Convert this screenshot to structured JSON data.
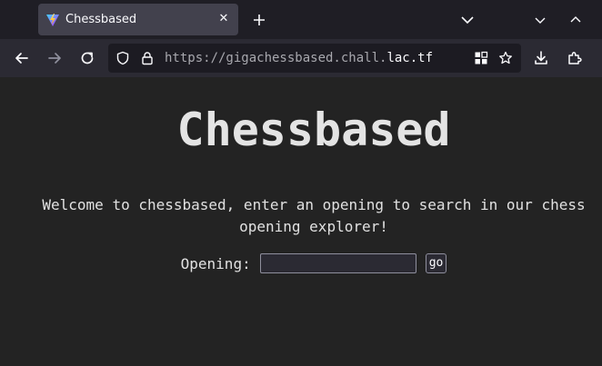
{
  "browser": {
    "tab": {
      "title": "Chessbased",
      "close_glyph": "✕",
      "favicon": "vite-logo-icon"
    },
    "icons": {
      "new_tab": "plus-icon",
      "tab_list": "chevron-down-icon",
      "minimize": "chevron-down-icon",
      "maximize": "chevron-up-icon",
      "back": "arrow-left-icon",
      "forward": "arrow-right-icon",
      "reload": "reload-icon",
      "tracking_protection": "shield-icon",
      "site_security": "lock-icon",
      "extensions_grid": "grid-icon",
      "bookmark": "star-icon",
      "downloads": "download-icon",
      "extensions": "puzzle-icon"
    },
    "url": {
      "prefix": "https://gigachessbased.chall.",
      "domain": "lac.tf"
    },
    "colors": {
      "tabstrip_bg": "#1f1e25",
      "active_tab_bg": "#42414d",
      "navbar_bg": "#2b2a33",
      "urlbar_bg": "#1c1b22",
      "page_bg": "#232323",
      "page_text": "#e1e1e1"
    }
  },
  "page": {
    "title": "Chessbased",
    "description": "Welcome to chessbased, enter an opening to search in our chess opening explorer!",
    "form": {
      "label": "Opening:",
      "input_value": "",
      "button_label": "go"
    }
  }
}
